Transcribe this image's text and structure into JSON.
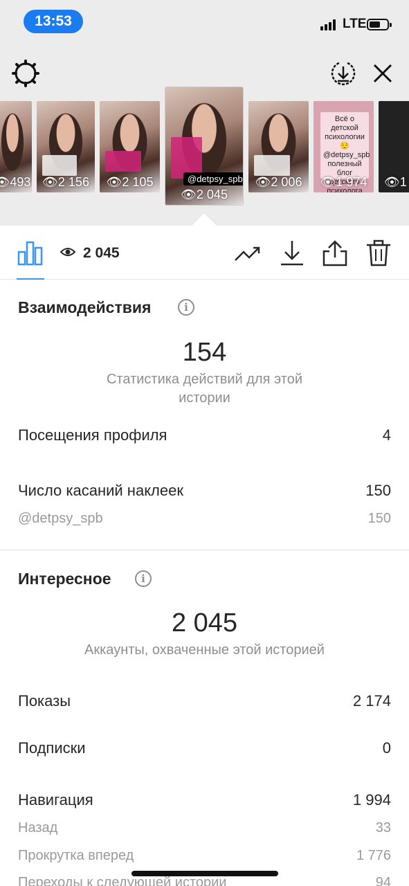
{
  "status_bar": {
    "time": "13:53",
    "network": "LTE"
  },
  "thumbnails": [
    {
      "views": "493"
    },
    {
      "views": "2 156"
    },
    {
      "views": "2 105"
    },
    {
      "views": "2 045",
      "handle": "@detpsy_spb",
      "selected": true
    },
    {
      "views": "2 006"
    },
    {
      "views": "1 974",
      "card_text": "Всё о детской психологии 😌 @detpsy_spb полезный блог детского психолога"
    },
    {
      "views": "1"
    }
  ],
  "action_bar": {
    "views_count": "2 045"
  },
  "interactions": {
    "title": "Взаимодействия",
    "total": "154",
    "caption": "Статистика действий для этой истории",
    "rows": [
      {
        "label": "Посещения профиля",
        "value": "4"
      },
      {
        "label": "Число касаний наклеек",
        "value": "150"
      }
    ],
    "sub_rows": [
      {
        "label": "@detpsy_spb",
        "value": "150"
      }
    ]
  },
  "discovery": {
    "title": "Интересное",
    "total": "2 045",
    "caption": "Аккаунты, охваченные этой историей",
    "rows": [
      {
        "label": "Показы",
        "value": "2 174"
      },
      {
        "label": "Подписки",
        "value": "0"
      },
      {
        "label": "Навигация",
        "value": "1 994"
      }
    ],
    "sub_rows": [
      {
        "label": "Назад",
        "value": "33"
      },
      {
        "label": "Прокрутка вперед",
        "value": "1 776"
      },
      {
        "label": "Переходы к следующей истории",
        "value": "94"
      }
    ]
  },
  "colors": {
    "accent": "#3897f0",
    "time_pill": "#1b7bf0",
    "sticker": "#d22378"
  },
  "icons": [
    "gear-icon",
    "download-circle-icon",
    "close-icon",
    "bar-chart-icon",
    "eye-icon",
    "trend-icon",
    "save-icon",
    "share-icon",
    "trash-icon",
    "info-icon"
  ]
}
